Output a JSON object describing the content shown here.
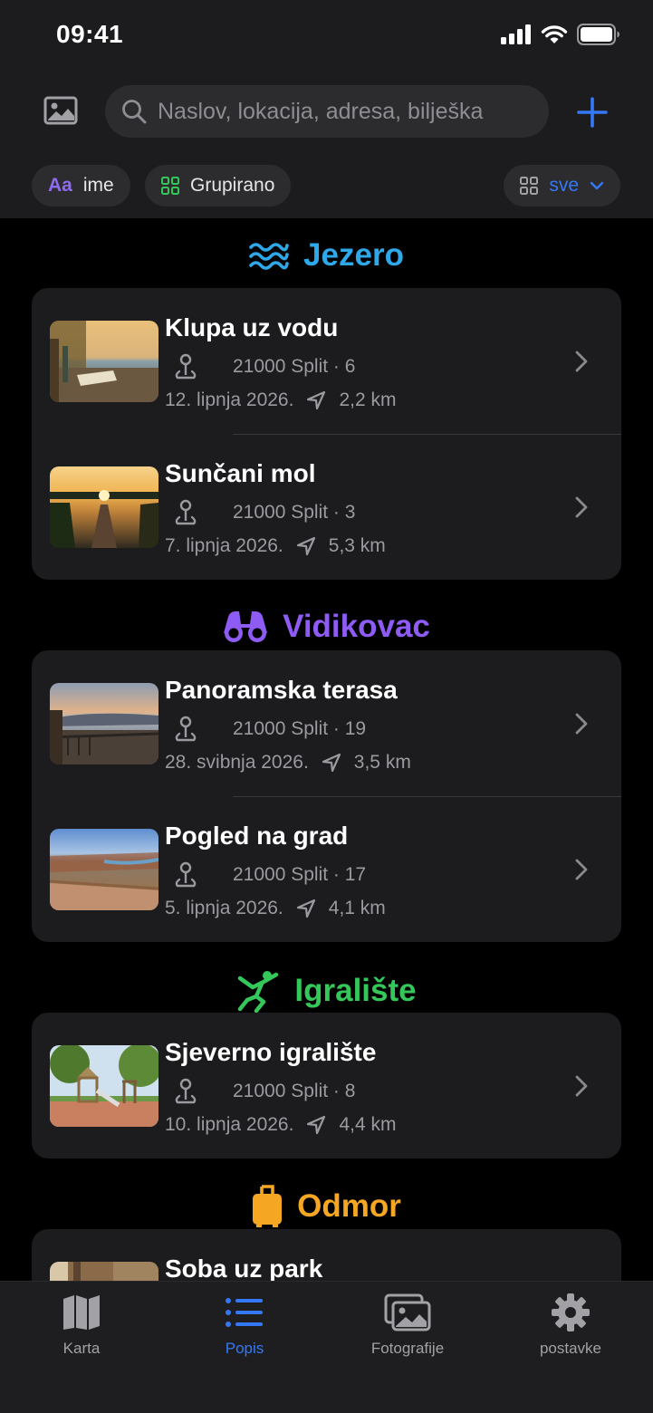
{
  "status": {
    "time": "09:41"
  },
  "search": {
    "placeholder": "Naslov, lokacija, adresa, bilješka"
  },
  "chips": {
    "sort_prefix": "Aa",
    "sort_label": "ime",
    "group_label": "Grupirano",
    "filter_label": "sve"
  },
  "sections": [
    {
      "title": "Jezero",
      "color": "#2ea8e8",
      "icon": "waves-icon",
      "items": [
        {
          "title": "Klupa uz vodu",
          "address": "21000 Split · 6",
          "date": "12. lipnja 2026.",
          "distance": "2,2 km"
        },
        {
          "title": "Sunčani mol",
          "address": "21000 Split · 3",
          "date": "7. lipnja 2026.",
          "distance": "5,3 km"
        }
      ]
    },
    {
      "title": "Vidikovac",
      "color": "#8e5cf5",
      "icon": "binoculars-icon",
      "items": [
        {
          "title": "Panoramska terasa",
          "address": "21000 Split · 19",
          "date": "28. svibnja 2026.",
          "distance": "3,5 km"
        },
        {
          "title": "Pogled na grad",
          "address": "21000 Split · 17",
          "date": "5. lipnja 2026.",
          "distance": "4,1 km"
        }
      ]
    },
    {
      "title": "Igralište",
      "color": "#34c759",
      "icon": "figure-jump-icon",
      "items": [
        {
          "title": "Sjeverno igralište",
          "address": "21000 Split · 8",
          "date": "10. lipnja 2026.",
          "distance": "4,4 km"
        }
      ]
    },
    {
      "title": "Odmor",
      "color": "#f5a623",
      "icon": "suitcase-icon",
      "items": [
        {
          "title": "Soba uz park"
        }
      ]
    }
  ],
  "tabs": [
    {
      "label": "Karta",
      "icon": "map-icon"
    },
    {
      "label": "Popis",
      "icon": "list-icon",
      "active": true
    },
    {
      "label": "Fotografije",
      "icon": "photos-icon"
    },
    {
      "label": "postavke",
      "icon": "gear-icon"
    }
  ]
}
